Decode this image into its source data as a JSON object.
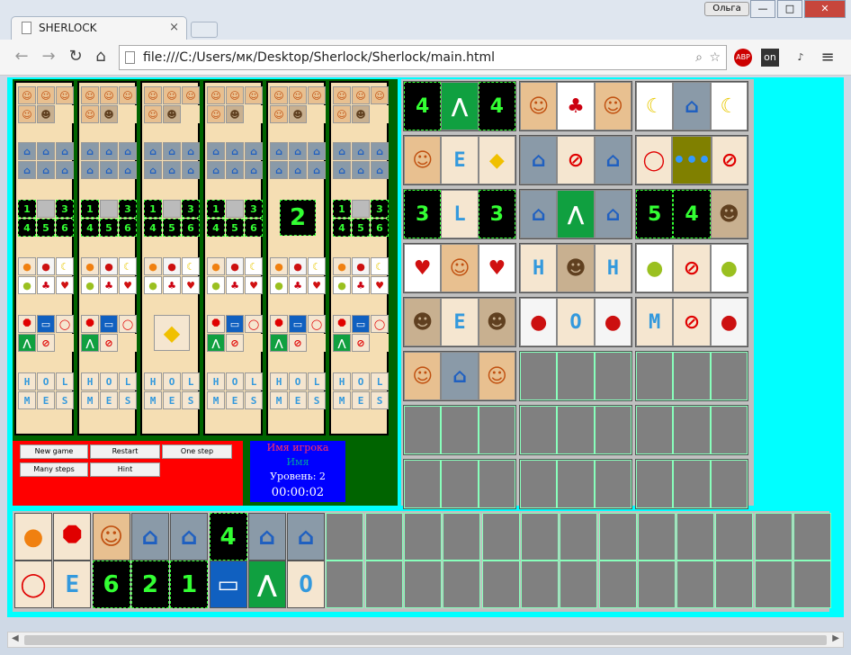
{
  "window": {
    "tab_title": "SHERLOCK",
    "user": "Ольга",
    "tab_close": "×",
    "min": "—",
    "max": "□",
    "close": "✕"
  },
  "toolbar": {
    "back": "←",
    "forward": "→",
    "reload": "↻",
    "home": "⌂",
    "url": "file:///C:/Users/мк/Desktop/Sherlock/Sherlock/main.html",
    "zoom_icon": "zoom-icon",
    "star_icon": "star-icon",
    "abp": "ABP",
    "on": "on",
    "music": "♪",
    "menu": "≡"
  },
  "board": {
    "numbers_rows": [
      [
        "1",
        "",
        "3"
      ],
      [
        "4",
        "5",
        "6"
      ]
    ],
    "col2_numbers": [
      [
        "1",
        "",
        "3"
      ],
      [
        "4",
        "5",
        "6"
      ]
    ],
    "col5_single": "2",
    "letters": [
      [
        "H",
        "O",
        "L"
      ],
      [
        "M",
        "E",
        "S"
      ]
    ]
  },
  "buttons": {
    "new_game": "New game",
    "restart": "Restart",
    "one_step": "One step",
    "many_steps": "Many steps",
    "hint": "Hint"
  },
  "info": {
    "player_label": "Имя игрока",
    "name": "Имя",
    "level": "Уровень: 2",
    "timer": "00:00:02"
  },
  "clues": [
    [
      "4",
      "road-icon",
      "4"
    ],
    [
      "woman-icon",
      "cherry-icon",
      "woman-icon"
    ],
    [
      "banana-icon",
      "house-icon",
      "banana-icon"
    ],
    [
      "woman-icon",
      "E",
      "diamond-sign-icon"
    ],
    [
      "house-icon",
      "no-parking-icon",
      "house-icon"
    ],
    [
      "speed-50-icon",
      "dots",
      "no-parking-icon"
    ],
    [
      "3",
      "L",
      "3"
    ],
    [
      "house-icon",
      "road-icon",
      "house-icon"
    ],
    [
      "5",
      "4",
      "man-icon"
    ],
    [
      "strawberry-icon",
      "woman-icon",
      "strawberry-icon"
    ],
    [
      "H",
      "man-icon",
      "H"
    ],
    [
      "pear-icon",
      "no-parking-icon",
      "pear-icon"
    ],
    [
      "man-icon",
      "E",
      "man-icon"
    ],
    [
      "apple-icon",
      "O",
      "apple-icon"
    ],
    [
      "M",
      "no-parking-icon",
      "apple-icon"
    ],
    [
      "woman-icon",
      "house-icon",
      "woman-icon"
    ]
  ],
  "bottom_top": [
    "orange-icon",
    "stop-sign-icon",
    "woman-icon",
    "house-icon",
    "house-icon",
    "4",
    "house-icon",
    "house-icon"
  ],
  "bottom_bot": [
    "speed-50-icon",
    "E",
    "6",
    "2",
    "1",
    "bus-sign-icon",
    "road-icon",
    "O"
  ],
  "colors": {
    "page": "#00ffff",
    "board": "#006400",
    "panel": "#ff0000",
    "info": "#0000ff",
    "num": "#33ff33",
    "letter": "#3399dd"
  }
}
